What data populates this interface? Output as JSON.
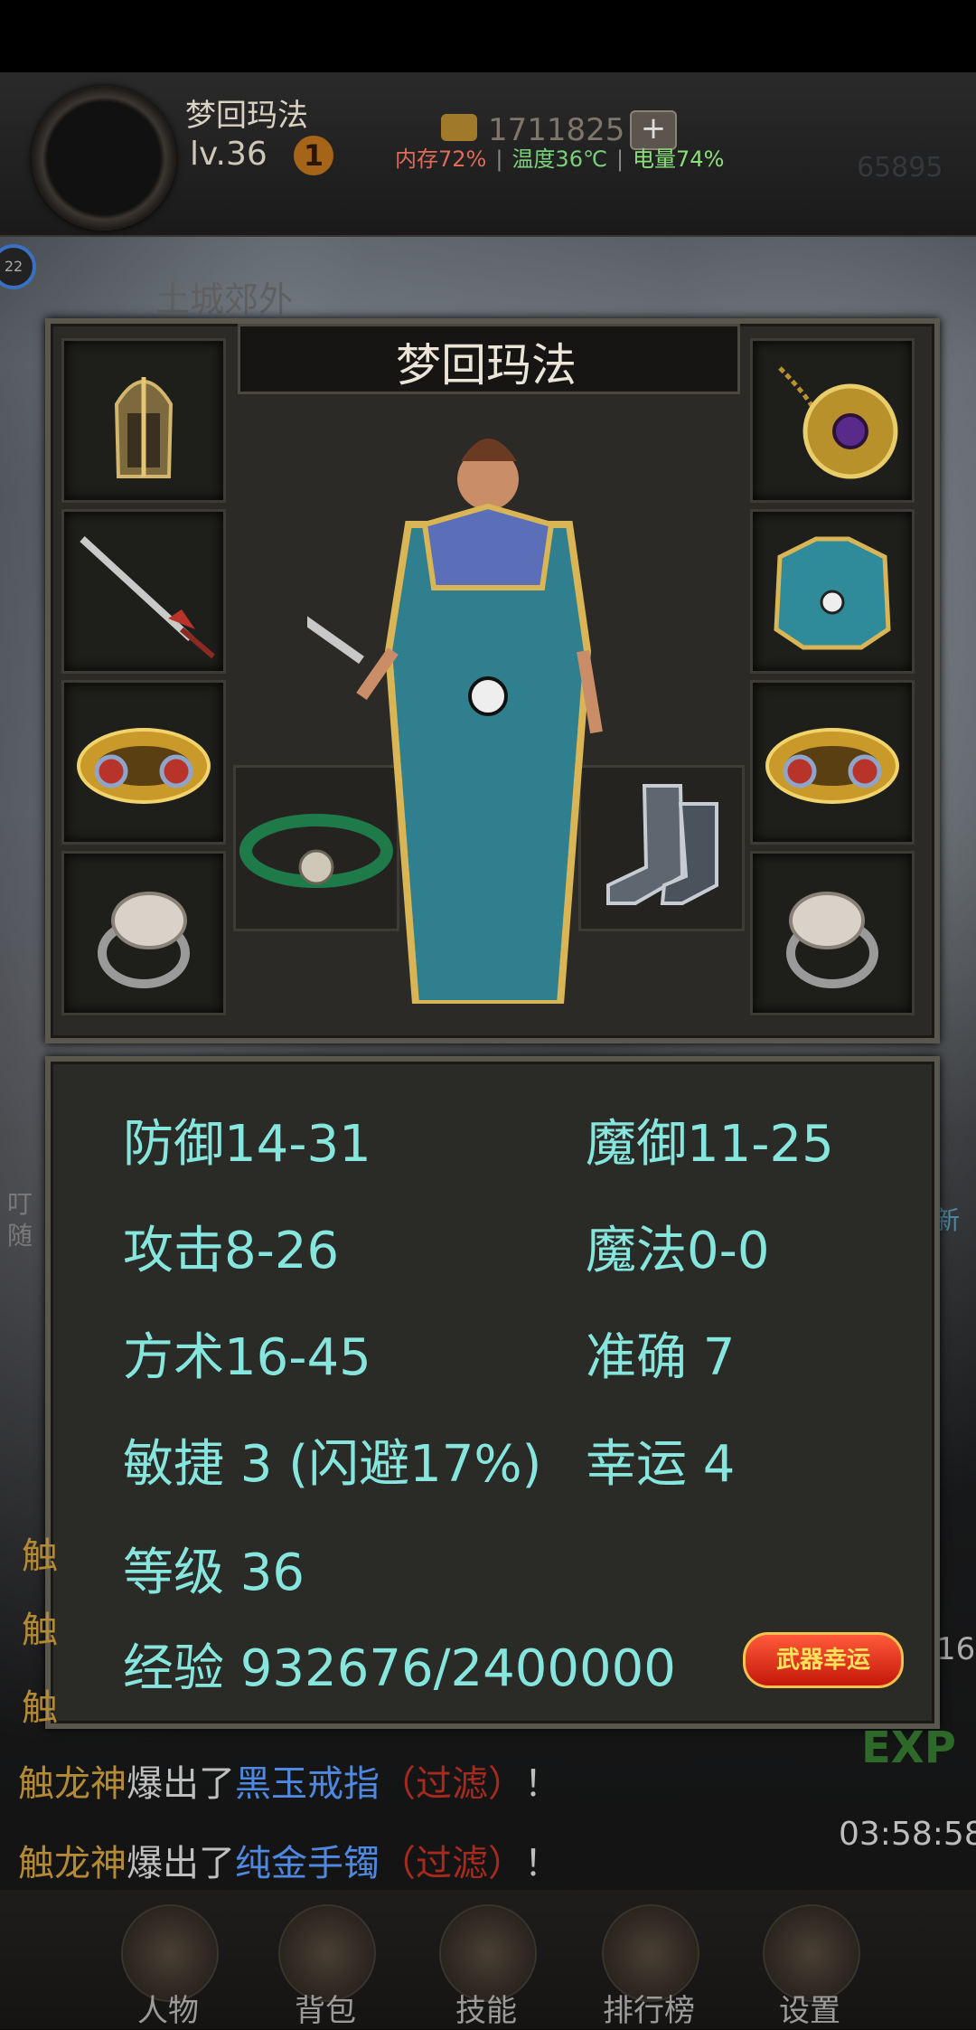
{
  "hud": {
    "player_name": "梦回玛法",
    "level": "lv.36",
    "level_badge": "1",
    "gold": "1711825",
    "gold_plus": "+",
    "memory": "内存72%",
    "temperature": "温度36℃",
    "battery": "电量74%",
    "right_number": "65895",
    "side_circle": "22"
  },
  "map": {
    "name": "土城郊外"
  },
  "side_fragments": {
    "left_a": "叮",
    "left_b": "随",
    "right_new": "新",
    "right_num": "16"
  },
  "equip_panel": {
    "title": "梦回玛法",
    "slots": {
      "left": [
        "helmet-icon",
        "sword-icon",
        "bracelet-icon",
        "ring-icon"
      ],
      "right": [
        "necklace-icon",
        "armor-icon",
        "bracelet-icon",
        "ring-icon"
      ],
      "bottom": [
        "belt-icon",
        "boots-icon"
      ]
    }
  },
  "stats": {
    "defense": "防御14-31",
    "magic_defense": "魔御11-25",
    "attack": "攻击8-26",
    "magic": "魔法0-0",
    "taoism": "方术16-45",
    "accuracy": "准确 7",
    "agility": "敏捷 3 (闪避17%)",
    "luck": "幸运 4",
    "level": "等级 36",
    "experience": "经验 932676/2400000",
    "luck_button": "武器幸运"
  },
  "chat": [
    {
      "name": "触龙神",
      "text": "爆出了",
      "item": "黑玉戒指",
      "filter": "（过滤）",
      "end": "！"
    },
    {
      "name": "触龙神",
      "text": "爆出了",
      "item": "纯金手镯",
      "filter": "（过滤）",
      "end": "！"
    }
  ],
  "chat_fragments": [
    "触",
    "触",
    "触"
  ],
  "exp_badge": "EXP",
  "timer": "03:58:58",
  "nav": [
    {
      "label": "人物"
    },
    {
      "label": "背包"
    },
    {
      "label": "技能"
    },
    {
      "label": "排行榜"
    },
    {
      "label": "设置"
    }
  ],
  "colors": {
    "stat_text": "#86e6de",
    "chat_name": "#b48a34",
    "chat_item": "#4f88e0",
    "chat_filter": "#a82a1f"
  }
}
